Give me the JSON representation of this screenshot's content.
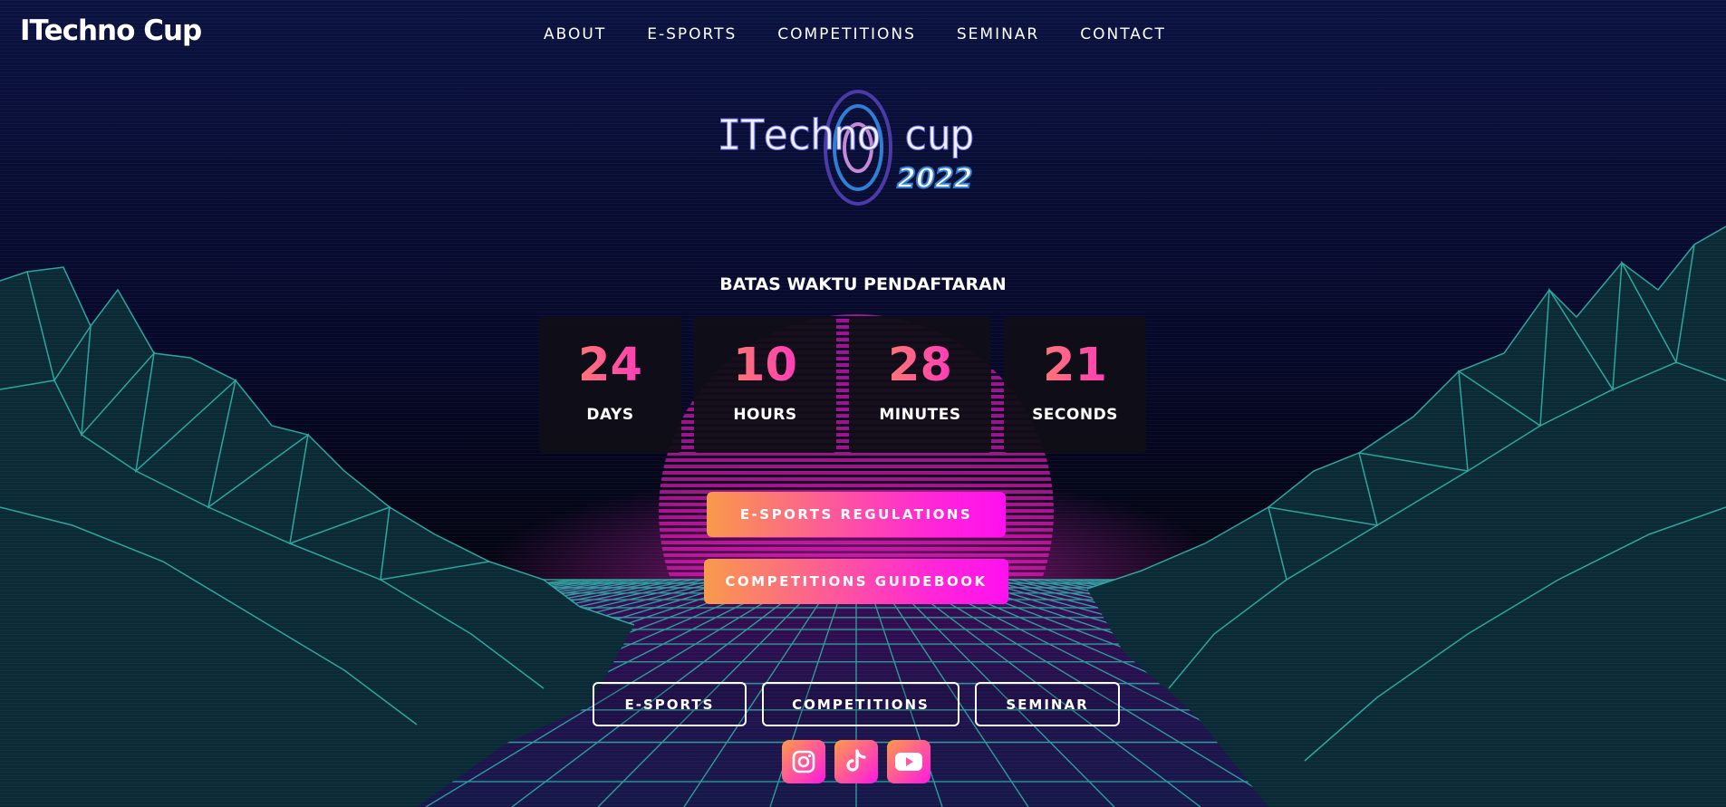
{
  "header": {
    "brand": "ITechno Cup",
    "nav": [
      "ABOUT",
      "E-SPORTS",
      "COMPETITIONS",
      "SEMINAR",
      "CONTACT"
    ]
  },
  "hero": {
    "logo_text": "ITechno cup",
    "logo_year": "2022"
  },
  "countdown": {
    "title": "BATAS WAKTU PENDAFTARAN",
    "units": [
      {
        "value": "24",
        "label": "DAYS"
      },
      {
        "value": "10",
        "label": "HOURS"
      },
      {
        "value": "28",
        "label": "MINUTES"
      },
      {
        "value": "21",
        "label": "SECONDS"
      }
    ]
  },
  "cta": {
    "regulations": "E-SPORTS REGULATIONS",
    "guidebook": "COMPETITIONS GUIDEBOOK"
  },
  "categories": [
    "E-SPORTS",
    "COMPETITIONS",
    "SEMINAR"
  ],
  "social": [
    {
      "icon": "instagram-icon"
    },
    {
      "icon": "tiktok-icon"
    },
    {
      "icon": "youtube-icon"
    }
  ],
  "colors": {
    "accent_start": "#ff9b48",
    "accent_end": "#ff18e4",
    "background": "#070a2a",
    "grid": "#2fb3a8"
  }
}
